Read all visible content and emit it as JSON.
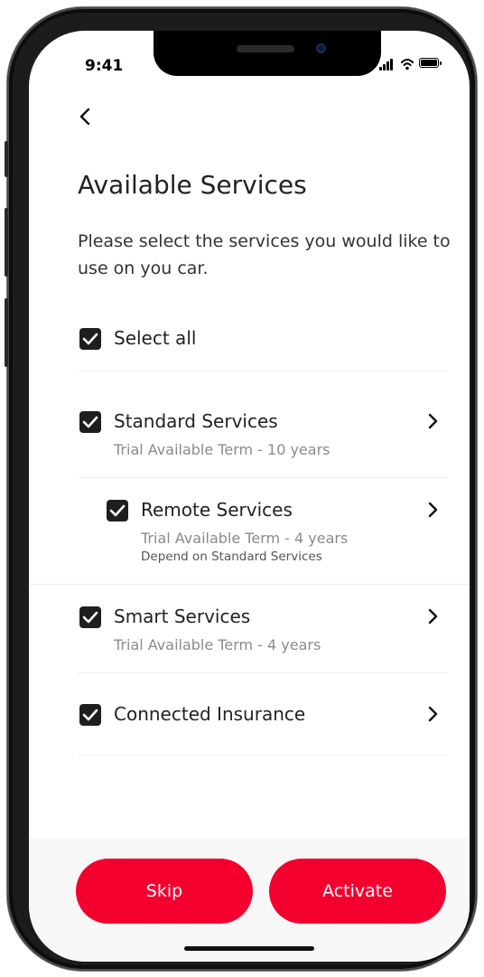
{
  "status_bar": {
    "time": "9:41"
  },
  "nav": {
    "back_icon": "chevron-left-icon"
  },
  "page": {
    "title": "Available Services",
    "subtitle": "Please select the services you would like to use on you car."
  },
  "select_all": {
    "label": "Select all",
    "checked": true
  },
  "services": [
    {
      "label": "Standard Services",
      "term": "Trial Available Term - 10 years",
      "note": "",
      "checked": true
    },
    {
      "label": "Remote Services",
      "term": "Trial Available Term - 4 years",
      "note": "Depend on Standard Services",
      "checked": true
    },
    {
      "label": "Smart Services",
      "term": "Trial Available Term - 4 years",
      "note": "",
      "checked": true
    },
    {
      "label": "Connected Insurance",
      "term": "",
      "note": "",
      "checked": true
    }
  ],
  "footer": {
    "skip_label": "Skip",
    "activate_label": "Activate"
  },
  "colors": {
    "accent": "#f4002e",
    "checkbox": "#1e1e1e"
  }
}
